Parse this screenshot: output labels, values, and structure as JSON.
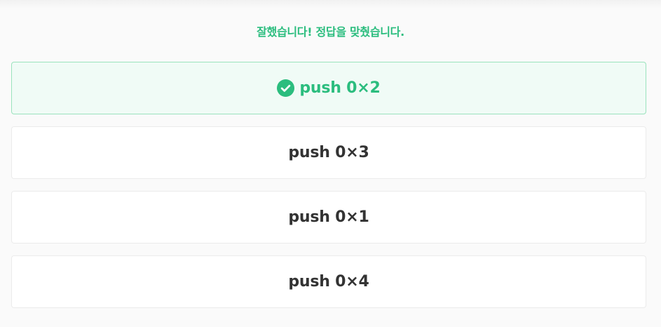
{
  "feedback": {
    "message": "잘했습니다! 정답을 맞췄습니다."
  },
  "options": [
    {
      "label": "push 0×2",
      "state": "correct",
      "icon": "check-circle-icon"
    },
    {
      "label": "push 0×3",
      "state": "default"
    },
    {
      "label": "push 0×1",
      "state": "default"
    },
    {
      "label": "push 0×4",
      "state": "default"
    }
  ],
  "colors": {
    "accent": "#2bbd7e",
    "correct_bg": "#f0fbf6",
    "correct_border": "#9ae3bd",
    "text": "#333333",
    "border": "#ebebeb"
  }
}
